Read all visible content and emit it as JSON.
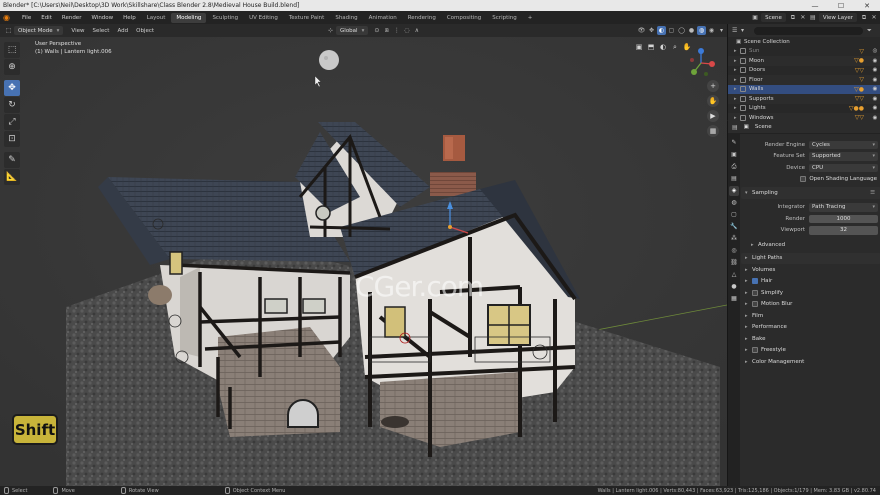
{
  "window": {
    "title": "Blender* [C:\\Users\\Neil\\Desktop\\3D Work\\Skillshare\\Class Blender 2.8\\Medieval House Build.blend]",
    "minimize": "—",
    "maximize": "☐",
    "close": "✕"
  },
  "menu": [
    "File",
    "Edit",
    "Render",
    "Window",
    "Help"
  ],
  "workspaces": [
    {
      "label": "Layout",
      "active": false
    },
    {
      "label": "Modeling",
      "active": true
    },
    {
      "label": "Sculpting",
      "active": false
    },
    {
      "label": "UV Editing",
      "active": false
    },
    {
      "label": "Texture Paint",
      "active": false
    },
    {
      "label": "Shading",
      "active": false
    },
    {
      "label": "Animation",
      "active": false
    },
    {
      "label": "Rendering",
      "active": false
    },
    {
      "label": "Compositing",
      "active": false
    },
    {
      "label": "Scripting",
      "active": false
    }
  ],
  "add_workspace": "+",
  "scene_name": "Scene",
  "view_layer": "View Layer",
  "viewport_header": {
    "mode": "Object Mode",
    "menus": [
      "View",
      "Select",
      "Add",
      "Object"
    ],
    "transform_orientation": "Global"
  },
  "viewport": {
    "perspective": "User Perspective",
    "active_object": "(1) Walls | Lantern light.006",
    "watermark": "CGer.com"
  },
  "shift_key": "Shift",
  "outliner": {
    "root": "Scene Collection",
    "items": [
      {
        "name": "Sun",
        "selected": false,
        "dim": true
      },
      {
        "name": "Moon",
        "selected": false,
        "dim": false
      },
      {
        "name": "Doors",
        "selected": false,
        "dim": false
      },
      {
        "name": "Floor",
        "selected": false,
        "dim": false
      },
      {
        "name": "Walls",
        "selected": true,
        "dim": false
      },
      {
        "name": "Supports",
        "selected": false,
        "dim": false
      },
      {
        "name": "Lights",
        "selected": false,
        "dim": false
      },
      {
        "name": "Windows",
        "selected": false,
        "dim": false
      }
    ]
  },
  "properties": {
    "context": "Scene",
    "render_engine_label": "Render Engine",
    "render_engine": "Cycles",
    "feature_set_label": "Feature Set",
    "feature_set": "Supported",
    "device_label": "Device",
    "device": "CPU",
    "osl_label": "Open Shading Language",
    "sampling": "Sampling",
    "integrator_label": "Integrator",
    "integrator": "Path Tracing",
    "render_label": "Render",
    "render_samples": "1000",
    "viewport_label": "Viewport",
    "viewport_samples": "32",
    "panels": {
      "advanced": "Advanced",
      "light_paths": "Light Paths",
      "volumes": "Volumes",
      "hair": "Hair",
      "simplify": "Simplify",
      "motion_blur": "Motion Blur",
      "film": "Film",
      "performance": "Performance",
      "bake": "Bake",
      "freestyle": "Freestyle",
      "color_management": "Color Management"
    }
  },
  "status": {
    "select": "Select",
    "move": "Move",
    "rotate": "Rotate View",
    "context_menu": "Object Context Menu",
    "stats": "Walls | Lantern light.006 | Verts:80,443 | Faces:63,923 | Tris:125,186 | Objects:1/179 | Mem: 3.83 GB | v2.80.74"
  },
  "colors": {
    "accent": "#4772b3",
    "selection": "#334d80",
    "orange": "#e87d0d"
  }
}
